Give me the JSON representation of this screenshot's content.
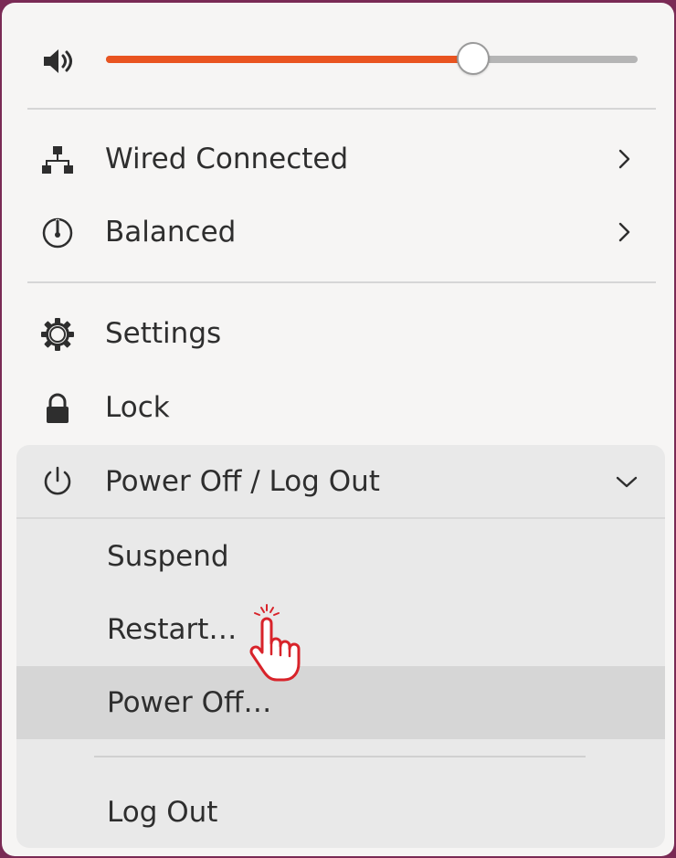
{
  "volume": {
    "icon": "speaker-icon",
    "level": 0.69
  },
  "items": {
    "network": {
      "label": "Wired Connected",
      "icon": "network-icon"
    },
    "power_mode": {
      "label": "Balanced",
      "icon": "power-mode-icon"
    },
    "settings": {
      "label": "Settings",
      "icon": "gear-icon"
    },
    "lock": {
      "label": "Lock",
      "icon": "lock-icon"
    }
  },
  "power_menu": {
    "label": "Power Off / Log Out",
    "icon": "power-icon",
    "expanded": true,
    "items": [
      {
        "label": "Suspend"
      },
      {
        "label": "Restart…"
      },
      {
        "label": "Power Off…"
      },
      {
        "label": "Log Out"
      }
    ]
  },
  "colors": {
    "accent": "#e95420",
    "menu_bg": "#f6f5f4",
    "submenu_bg": "#e9e9e9",
    "hover_bg": "#d6d6d6",
    "cursor": "#d8232a"
  }
}
